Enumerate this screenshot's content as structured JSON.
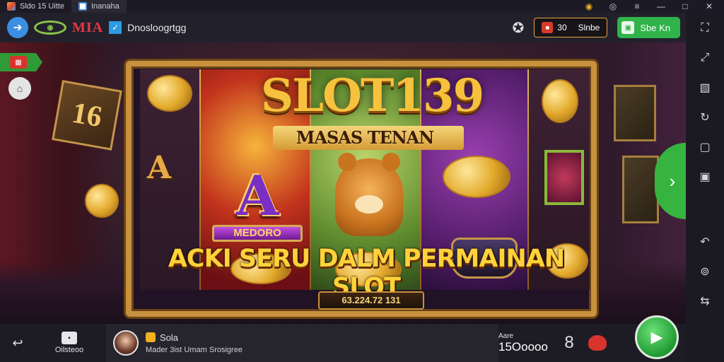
{
  "titlebar": {
    "tabs": [
      {
        "label": "Sldo 15 Uitte",
        "icon": "app-logo-icon"
      },
      {
        "label": "Inanaha",
        "icon": "window-icon"
      }
    ],
    "controls": {
      "coin": "◉",
      "help": "◎",
      "menu": "≡",
      "minimize": "—",
      "maximize": "□",
      "close": "✕"
    }
  },
  "topbar": {
    "brand": "MIA",
    "app_title": "Dnosloogrtgg",
    "coin_value": "30",
    "coin_label": "Slnbe",
    "green_button_label": "Sbe Kn"
  },
  "sidebar_right": {
    "items": [
      "fullscreen-icon",
      "expand-icon",
      "screen-icon",
      "sync-icon",
      "frame-icon",
      "window-icon",
      "back-icon",
      "location-icon",
      "swap-icon"
    ]
  },
  "game": {
    "title": "SLOT139",
    "subtitle": "MASAS TENAN",
    "letter": "A",
    "letter_plate": "MEDORO",
    "tagline": "ACKI SERU  DALM PERMAINAN SLOT",
    "bottom_plate": "63.224.72 131",
    "dice_number": "16"
  },
  "bottombar": {
    "settings_label": "Oilsteoo",
    "name": "Sola",
    "description": "Mader 3ist Umam Srosigree",
    "stat_label": "Aare",
    "stat_value": "15Ooooo",
    "eight": "8"
  },
  "colors": {
    "accent_green": "#2fb34a",
    "gold": "#f6c23d",
    "brand_red": "#e53945"
  }
}
